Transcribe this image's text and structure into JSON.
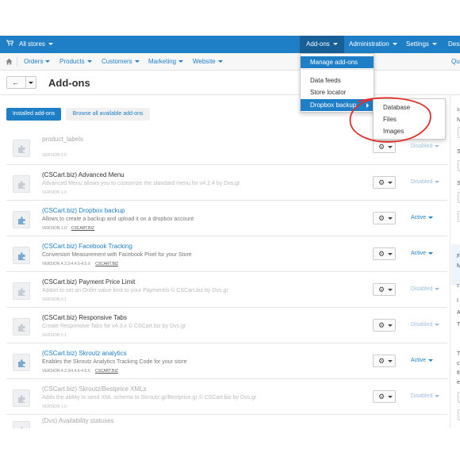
{
  "topbar": {
    "store_label": "All stores",
    "tabs": [
      "Add-ons",
      "Administration",
      "Settings",
      "Desi"
    ]
  },
  "subnav": {
    "items": [
      "Orders",
      "Products",
      "Customers",
      "Marketing",
      "Website"
    ],
    "right_cut": "Qu"
  },
  "page": {
    "title": "Add-ons",
    "back_arrow": "←"
  },
  "tabs": {
    "installed": "Installed add-ons",
    "browse": "Browse all available add-ons"
  },
  "addons_menu": {
    "items": [
      "Manage add-ons",
      "Data feeds",
      "Store locator",
      "Dropbox backup"
    ]
  },
  "dropbox_submenu": {
    "items": [
      "Database",
      "Files",
      "Images"
    ]
  },
  "addons": [
    {
      "name": "product_labels",
      "description": "",
      "version": "VERSION 2.0",
      "author": "",
      "status": "Disabled"
    },
    {
      "name": "(CSCart.biz) Advanced Menu",
      "description": "Advanced Menu allows you to customize the standard menu for v4.2.4 by Dvs.gr.",
      "version": "VERSION 1.0",
      "author": "",
      "status": "Disabled"
    },
    {
      "name": "(CSCart.biz) Dropbox backup",
      "description": "Allows to create a backup and upload it on a dropbox account",
      "version": "VERSION 1.0",
      "author": "CSCART.BIZ",
      "status": "Active"
    },
    {
      "name": "(CSCart.biz) Facebook Tracking",
      "description": "Conversion Measurement with Facebook Pixel for your Store",
      "version": "VERSION 4.3.3-4.4.5-4.5.X",
      "author": "CSCART.BIZ",
      "status": "Active"
    },
    {
      "name": "(CSCart.biz) Payment Price Limit",
      "description": "Addon to set an Order value limit to your Payment/s © CSCart.biz by Dvs.gr",
      "version": "VERSION 0.1",
      "author": "",
      "status": "Disabled"
    },
    {
      "name": "(CSCart.biz) Responsive Tabs",
      "description": "Create Responsive Tabs for v4.3.x © CSCart.biz by Dvs.gr",
      "version": "VERSION 0.1",
      "author": "",
      "status": "Disabled"
    },
    {
      "name": "(CSCart.biz) Skroutz analytics",
      "description": "Enables the Skroutz Analytics Tracking Code for your store",
      "version": "VERSION 4.2.3/4.4.6-4.5.X",
      "author": "CSCART.BIZ",
      "status": "Active"
    },
    {
      "name": "(CSCart.biz) Skroutz/Bestprice XMLs",
      "description": "Adds the ability to send XML schema to Skroutz.gr/Bestprice.gr © CSCart.biz by Dvs.gr",
      "version": "VERSION 1.0",
      "author": "",
      "status": "Disabled"
    },
    {
      "name": "(Dvs) Availability statuses",
      "description": "",
      "version": "",
      "author": "",
      "status": ""
    }
  ],
  "sidebar_letters": [
    "S",
    "N",
    "S",
    "S",
    "F",
    "M",
    "C",
    "I",
    "A",
    "T",
    "T",
    "c",
    "tl",
    "e"
  ],
  "icons": {
    "cart": "cart-icon",
    "home": "home-icon",
    "gear": "gear-icon",
    "addon": "puzzle-icon"
  },
  "colors": {
    "primary": "#1f7fc6",
    "annotation": "#e0302a"
  }
}
